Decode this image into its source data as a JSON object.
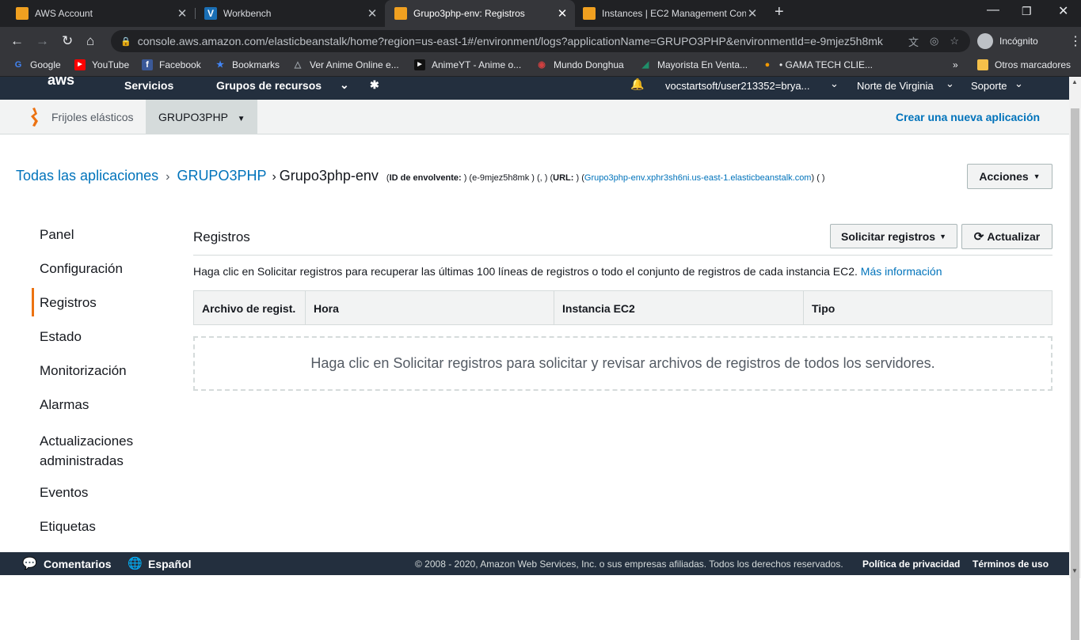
{
  "browser": {
    "tabs": [
      {
        "title": "AWS Account"
      },
      {
        "title": "Workbench"
      },
      {
        "title": "Grupo3php-env: Registros"
      },
      {
        "title": "Instances | EC2 Management Con"
      }
    ],
    "url": "console.aws.amazon.com/elasticbeanstalk/home?region=us-east-1#/environment/logs?applicationName=GRUPO3PHP&environmentId=e-9mjez5h8mk",
    "profile": "Incógnito",
    "bookmarks": [
      "Google",
      "YouTube",
      "Facebook",
      "Bookmarks",
      "Ver Anime Online e...",
      "AnimeYT - Anime o...",
      "Mundo Donghua",
      "Mayorista En Venta...",
      "• GAMA TECH CLIE...",
      "»",
      "Otros marcadores"
    ]
  },
  "aws_nav": {
    "logo": "aws",
    "services": "Servicios",
    "resource_groups": "Grupos de recursos",
    "account": "vocstartsoft/user213352=brya...",
    "region": "Norte de Virginia",
    "support": "Soporte"
  },
  "eb_bar": {
    "home": "Frijoles elásticos",
    "app": "GRUPO3PHP",
    "create": "Crear una nueva aplicación"
  },
  "breadcrumb": {
    "all_apps": "Todas las aplicaciones",
    "sep": "›",
    "app": "GRUPO3PHP",
    "env": "Grupo3php-env",
    "env_id_label": "ID de envolvente:",
    "env_id": ") (e-9mjez5h8mk ) (, ) (",
    "url_label": "URL:",
    "url_open": ") (",
    "url_value": "Grupo3php-env.xphr3sh6ni.us-east-1.elasticbeanstalk.com",
    "url_close": ") ( )"
  },
  "actions_button": "Acciones",
  "sidebar": [
    "Panel",
    "Configuración",
    "Registros",
    "Estado",
    "Monitorización",
    "Alarmas",
    "Actualizaciones administradas",
    "Eventos",
    "Etiquetas"
  ],
  "main": {
    "title": "Registros",
    "request_button": "Solicitar registros",
    "refresh_button": "Actualizar",
    "description": "Haga clic en Solicitar registros para recuperar las últimas 100 líneas de registros o todo el conjunto de registros de cada instancia EC2.",
    "more_info": "Más información",
    "columns": [
      "Archivo de regist.",
      "Hora",
      "Instancia EC2",
      "Tipo"
    ],
    "empty_message": "Haga clic en Solicitar registros para solicitar y revisar archivos de registros de todos los servidores."
  },
  "footer": {
    "feedback": "Comentarios",
    "language": "Español",
    "copyright": "© 2008 - 2020, Amazon Web Services, Inc. o sus empresas afiliadas. Todos los derechos reservados.",
    "privacy": "Política de privacidad",
    "terms": "Términos de uso"
  }
}
